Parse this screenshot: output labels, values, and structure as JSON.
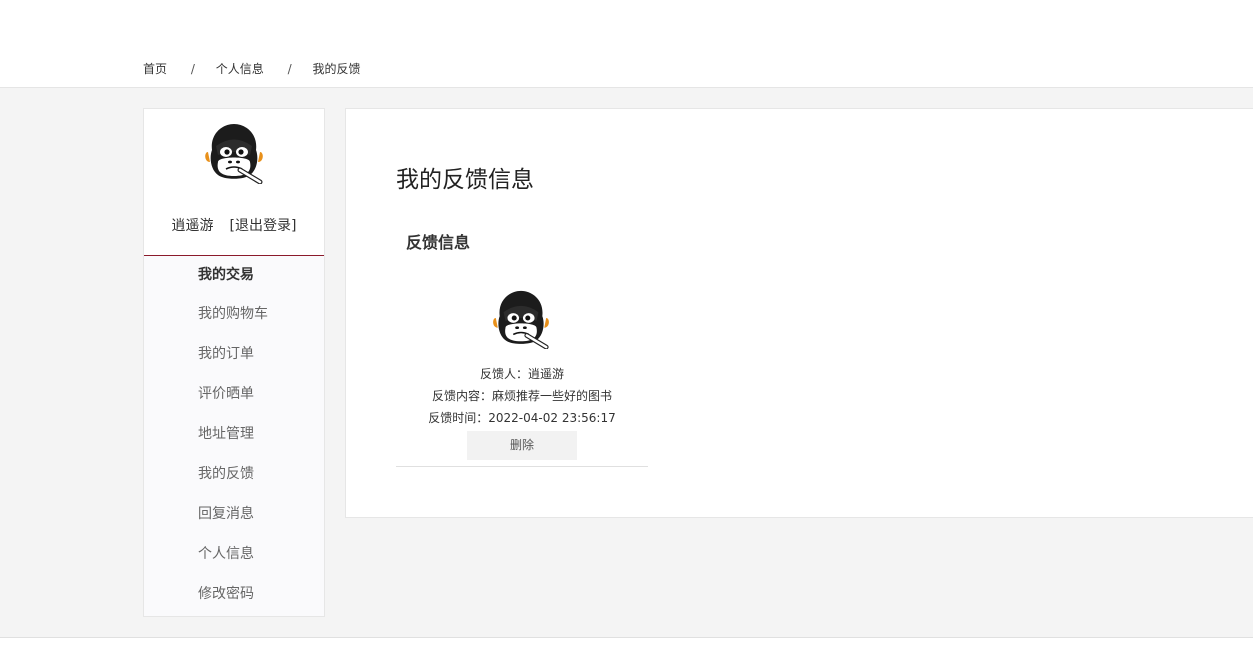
{
  "breadcrumb": {
    "items": [
      "首页",
      "个人信息",
      "我的反馈"
    ],
    "separator": "/"
  },
  "sidebar": {
    "username": "逍遥游",
    "logout_label": "[退出登录]",
    "avatar_icon": "gorilla-avatar-icon",
    "group_label": "我的交易",
    "items": [
      "我的购物车",
      "我的订单",
      "评价晒单",
      "地址管理",
      "我的反馈",
      "回复消息",
      "个人信息",
      "修改密码"
    ],
    "accent_color": "#8b1a2b"
  },
  "main": {
    "title": "我的反馈信息",
    "section_title": "反馈信息",
    "feedback": {
      "avatar_icon": "gorilla-avatar-icon",
      "author_line": "反馈人：逍遥游",
      "content_line": "反馈内容：麻烦推荐一些好的图书",
      "time_line": "反馈时间：2022-04-02 23:56:17",
      "delete_label": "删除"
    }
  }
}
